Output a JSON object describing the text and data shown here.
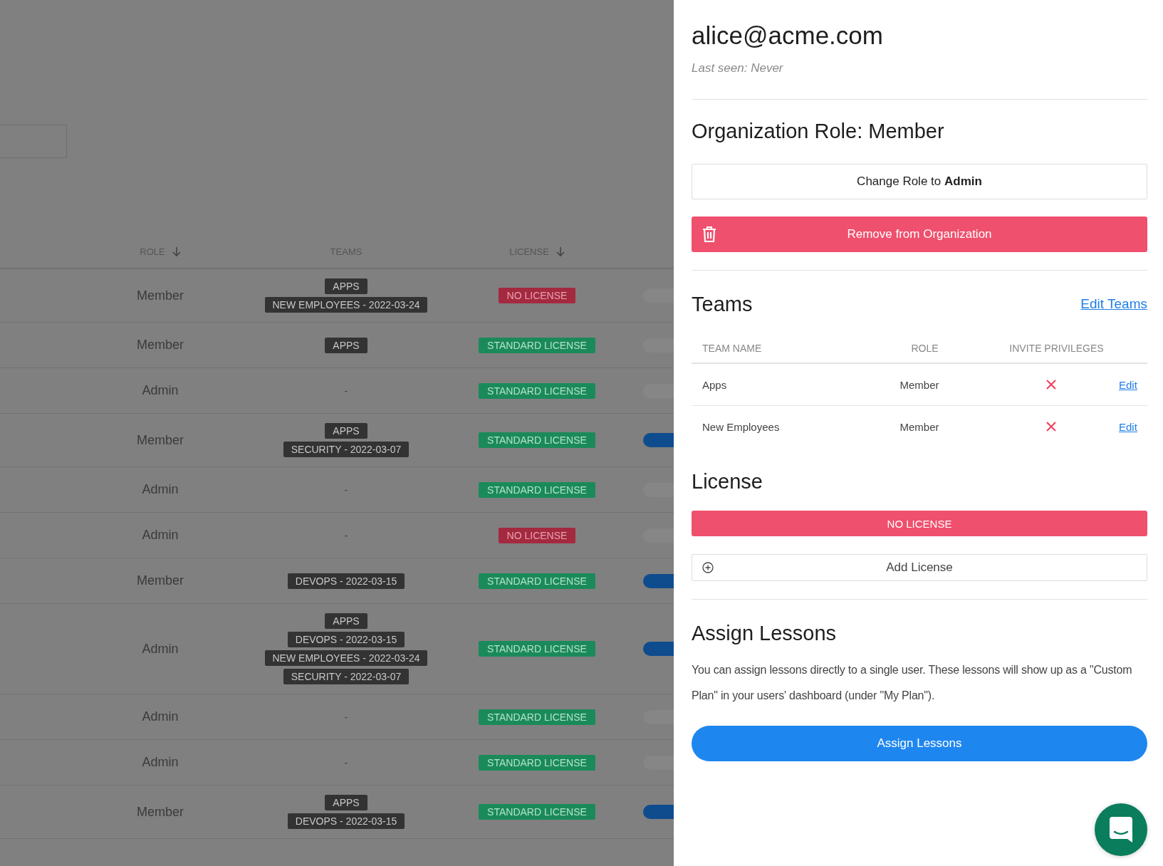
{
  "table": {
    "columns": [
      {
        "label": "ROLE",
        "sorted": true
      },
      {
        "label": "TEAMS",
        "sorted": false
      },
      {
        "label": "LICENSE",
        "sorted": true
      }
    ],
    "rows": [
      {
        "role": "Member",
        "teams": [
          "APPS",
          "NEW EMPLOYEES - 2022-03-24"
        ],
        "license": {
          "label": "NO LICENSE",
          "kind": "none"
        },
        "enabled": false
      },
      {
        "role": "Member",
        "teams": [
          "APPS"
        ],
        "license": {
          "label": "STANDARD LICENSE",
          "kind": "standard"
        },
        "enabled": false
      },
      {
        "role": "Admin",
        "no_teams": "-",
        "license": {
          "label": "STANDARD LICENSE",
          "kind": "standard"
        },
        "enabled": false
      },
      {
        "role": "Member",
        "teams": [
          "APPS",
          "SECURITY - 2022-03-07"
        ],
        "license": {
          "label": "STANDARD LICENSE",
          "kind": "standard"
        },
        "enabled": true
      },
      {
        "role": "Admin",
        "no_teams": "-",
        "license": {
          "label": "STANDARD LICENSE",
          "kind": "standard"
        },
        "enabled": false
      },
      {
        "role": "Admin",
        "no_teams": "-",
        "license": {
          "label": "NO LICENSE",
          "kind": "none"
        },
        "enabled": false
      },
      {
        "role": "Member",
        "teams": [
          "DEVOPS - 2022-03-15"
        ],
        "license": {
          "label": "STANDARD LICENSE",
          "kind": "standard"
        },
        "enabled": true
      },
      {
        "role": "Admin",
        "teams": [
          "APPS",
          "DEVOPS - 2022-03-15",
          "NEW EMPLOYEES - 2022-03-24",
          "SECURITY - 2022-03-07"
        ],
        "license": {
          "label": "STANDARD LICENSE",
          "kind": "standard"
        },
        "enabled": true
      },
      {
        "role": "Admin",
        "no_teams": "-",
        "license": {
          "label": "STANDARD LICENSE",
          "kind": "standard"
        },
        "enabled": false
      },
      {
        "role": "Admin",
        "no_teams": "-",
        "license": {
          "label": "STANDARD LICENSE",
          "kind": "standard"
        },
        "enabled": false
      },
      {
        "role": "Member",
        "teams": [
          "APPS",
          "DEVOPS - 2022-03-15"
        ],
        "license": {
          "label": "STANDARD LICENSE",
          "kind": "standard"
        },
        "enabled": true
      }
    ]
  },
  "drawer": {
    "user": {
      "email": "alice@acme.com",
      "last_seen": "Last seen: Never"
    },
    "role_section": {
      "heading": "Organization Role: Member",
      "change_button": "Change Role to **Admin**",
      "remove_button": "Remove from Organization"
    },
    "teams_section": {
      "heading": "Teams",
      "edit_link": "Edit Teams",
      "columns": [
        "TEAM NAME",
        "ROLE",
        "INVITE PRIVILEGES"
      ],
      "rows": [
        {
          "name": "Apps",
          "role": "Member",
          "invite": false,
          "edit": "Edit"
        },
        {
          "name": "New Employees",
          "role": "Member",
          "invite": false,
          "edit": "Edit"
        }
      ]
    },
    "license_section": {
      "heading": "License",
      "current": {
        "label": "NO LICENSE",
        "kind": "none"
      },
      "add_button": "Add License"
    },
    "lessons_section": {
      "heading": "Assign Lessons",
      "text": "You can assign lessons directly to a single user. These lessons will show up as a \"Custom Plan\" in your users' dashboard (under \"My Plan\").",
      "button": "Assign Lessons"
    }
  }
}
